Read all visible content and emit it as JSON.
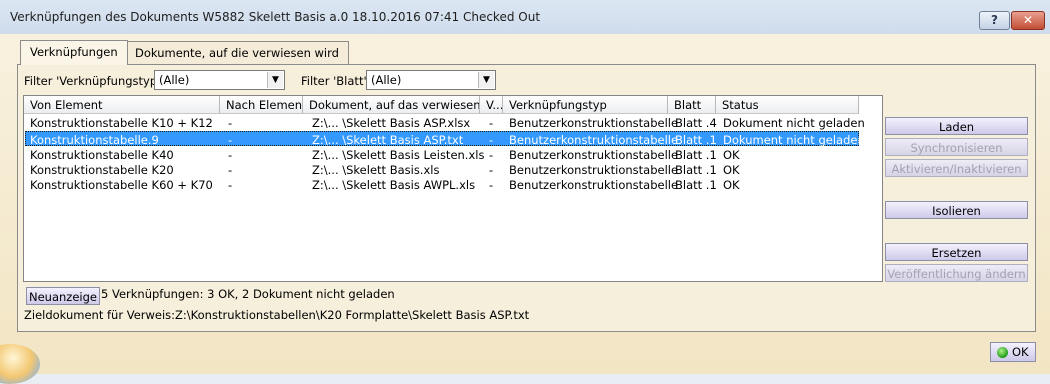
{
  "window": {
    "title": "Verknüpfungen des Dokuments W5882 Skelett Basis a.0 18.10.2016 07:41 Checked Out",
    "help_label": "?",
    "close_label": "✕"
  },
  "tabs": [
    {
      "label": "Verknüpfungen",
      "active": true
    },
    {
      "label": "Dokumente, auf die verwiesen wird",
      "active": false
    }
  ],
  "filters": {
    "type_label": "Filter 'Verknüpfungstyp':",
    "type_value": "(Alle)",
    "sheet_label": "Filter 'Blatt':",
    "sheet_value": "(Alle)"
  },
  "table": {
    "columns": [
      "Von Element",
      "Nach Element",
      "Dokument, auf das verwiesen...",
      "V...",
      "Verknüpfungstyp",
      "Blatt",
      "Status"
    ],
    "rows": [
      [
        "Konstruktionstabelle K10 + K12",
        "-",
        "Z:\\... \\Skelett Basis ASP.xlsx",
        "-",
        "Benutzerkonstruktionstabelle",
        "Blatt .4",
        "Dokument nicht geladen"
      ],
      [
        "Konstruktionstabelle.9",
        "-",
        "Z:\\... \\Skelett Basis ASP.txt",
        "-",
        "Benutzerkonstruktionstabelle",
        "Blatt .1",
        "Dokument nicht geladen"
      ],
      [
        "Konstruktionstabelle K40",
        "-",
        "Z:\\... \\Skelett Basis Leisten.xls",
        "-",
        "Benutzerkonstruktionstabelle",
        "Blatt .1",
        "OK"
      ],
      [
        "Konstruktionstabelle K20",
        "-",
        "Z:\\... \\Skelett Basis.xls",
        "-",
        "Benutzerkonstruktionstabelle",
        "Blatt .1",
        "OK"
      ],
      [
        "Konstruktionstabelle K60 + K70",
        "-",
        "Z:\\... \\Skelett Basis AWPL.xls",
        "-",
        "Benutzerkonstruktionstabelle",
        "Blatt .1",
        "OK"
      ]
    ],
    "selected_row": 1
  },
  "actions": {
    "laden": "Laden",
    "synchronisieren": "Synchronisieren",
    "aktivieren": "Aktivieren/Inaktivieren",
    "isolieren": "Isolieren",
    "ersetzen": "Ersetzen",
    "veroeffentlichung": "Veröffentlichung ändern"
  },
  "footer": {
    "refresh_label": "Neuanzeige",
    "summary": "5 Verknüpfungen: 3 OK, 2 Dokument nicht geladen",
    "target": "Zieldokument für Verweis:Z:\\Konstruktionstabellen\\K20 Formplatte\\Skelett Basis ASP.txt",
    "ok_label": "OK"
  }
}
